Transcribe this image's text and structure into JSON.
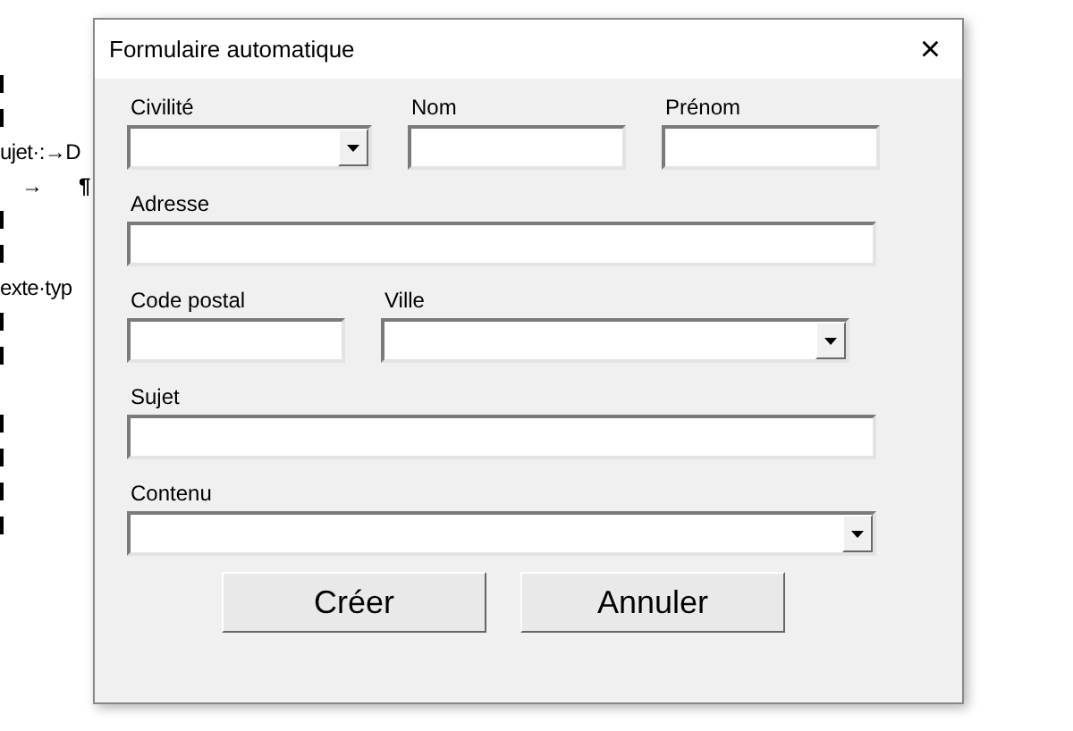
{
  "document": {
    "lines": [
      {
        "kind": "mark"
      },
      {
        "kind": "mark"
      },
      {
        "kind": "text",
        "text": "ujet·:→D"
      },
      {
        "kind": "pair",
        "text": "→",
        "mark": "¶"
      },
      {
        "kind": "mark"
      },
      {
        "kind": "mark"
      },
      {
        "kind": "text",
        "text": "exte·typ"
      },
      {
        "kind": "mark"
      },
      {
        "kind": "mark"
      },
      {
        "kind": "gap"
      },
      {
        "kind": "mark"
      },
      {
        "kind": "mark"
      },
      {
        "kind": "mark"
      },
      {
        "kind": "mark"
      }
    ]
  },
  "dialog": {
    "title": "Formulaire automatique",
    "close": "×",
    "rows": [
      [
        {
          "label": "Civilité",
          "kind": "combo"
        },
        {
          "label": "Nom",
          "kind": "text"
        },
        {
          "label": "Prénom",
          "kind": "text"
        }
      ],
      [
        {
          "label": "Adresse",
          "kind": "text"
        }
      ],
      [
        {
          "label": "Code postal",
          "kind": "text"
        },
        {
          "label": "Ville",
          "kind": "combo"
        }
      ],
      [
        {
          "label": "Sujet",
          "kind": "text"
        }
      ],
      [
        {
          "label": "Contenu",
          "kind": "combo"
        }
      ]
    ],
    "buttons": [
      "Créer",
      "Annuler"
    ]
  }
}
